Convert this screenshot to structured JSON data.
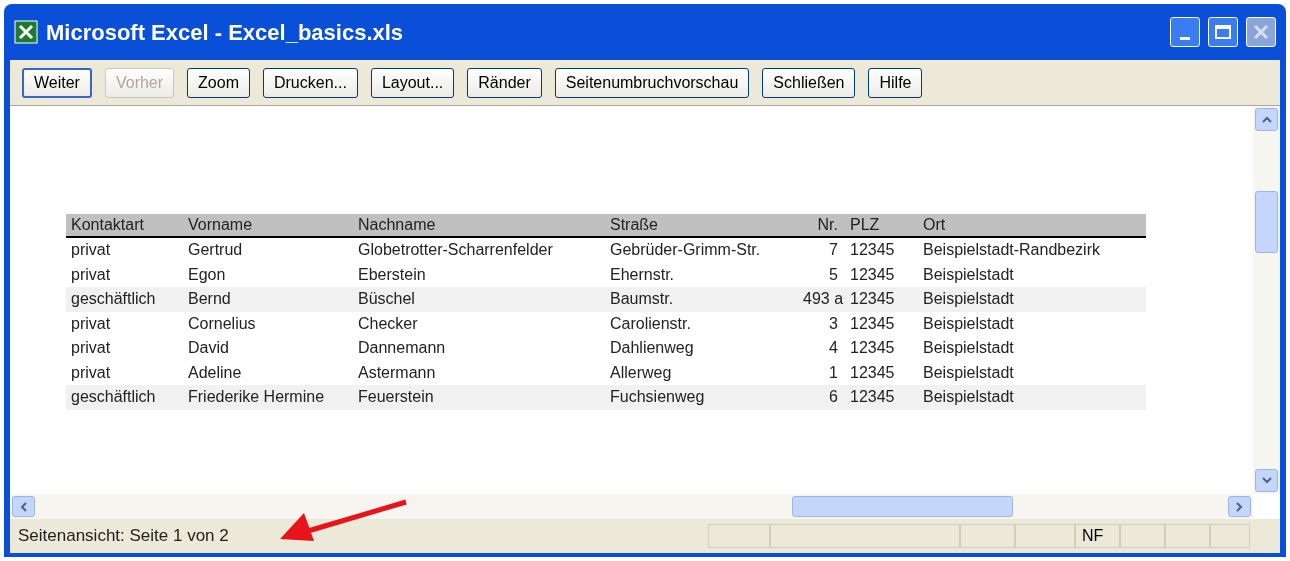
{
  "window": {
    "title": "Microsoft Excel - Excel_basics.xls"
  },
  "toolbar": [
    {
      "label": "Weiter",
      "disabled": false,
      "focused": true
    },
    {
      "label": "Vorher",
      "disabled": true,
      "focused": false
    },
    {
      "label": "Zoom",
      "disabled": false,
      "focused": false
    },
    {
      "label": "Drucken...",
      "disabled": false,
      "focused": false
    },
    {
      "label": "Layout...",
      "disabled": false,
      "focused": false
    },
    {
      "label": "Ränder",
      "disabled": false,
      "focused": false
    },
    {
      "label": "Seitenumbruchvorschau",
      "disabled": false,
      "focused": false
    },
    {
      "label": "Schließen",
      "disabled": false,
      "focused": false
    },
    {
      "label": "Hilfe",
      "disabled": false,
      "focused": false
    }
  ],
  "table": {
    "columns": [
      "Kontaktart",
      "Vorname",
      "Nachname",
      "Straße",
      "Nr.",
      "PLZ",
      "Ort"
    ],
    "rows": [
      {
        "shaded": false,
        "cells": [
          "privat",
          "Gertrud",
          "Globetrotter-Scharrenfelder",
          "Gebrüder-Grimm-Str.",
          "7",
          "12345",
          "Beispielstadt-Randbezirk"
        ]
      },
      {
        "shaded": false,
        "cells": [
          "privat",
          "Egon",
          "Eberstein",
          "Ehernstr.",
          "5",
          "12345",
          "Beispielstadt"
        ]
      },
      {
        "shaded": true,
        "cells": [
          "geschäftlich",
          "Bernd",
          "Büschel",
          "Baumstr.",
          "493 a",
          "12345",
          "Beispielstadt"
        ]
      },
      {
        "shaded": false,
        "cells": [
          "privat",
          "Cornelius",
          "Checker",
          "Carolienstr.",
          "3",
          "12345",
          "Beispielstadt"
        ]
      },
      {
        "shaded": false,
        "cells": [
          "privat",
          "David",
          "Dannemann",
          "Dahlienweg",
          "4",
          "12345",
          "Beispielstadt"
        ]
      },
      {
        "shaded": false,
        "cells": [
          "privat",
          "Adeline",
          "Astermann",
          "Allerweg",
          "1",
          "12345",
          "Beispielstadt"
        ]
      },
      {
        "shaded": true,
        "cells": [
          "geschäftlich",
          "Friederike Hermine",
          "Feuerstein",
          "Fuchsienweg",
          "6",
          "12345",
          "Beispielstadt"
        ]
      }
    ]
  },
  "status_bar": {
    "text": "Seitenansicht: Seite 1 von 2",
    "indicator": "NF"
  }
}
